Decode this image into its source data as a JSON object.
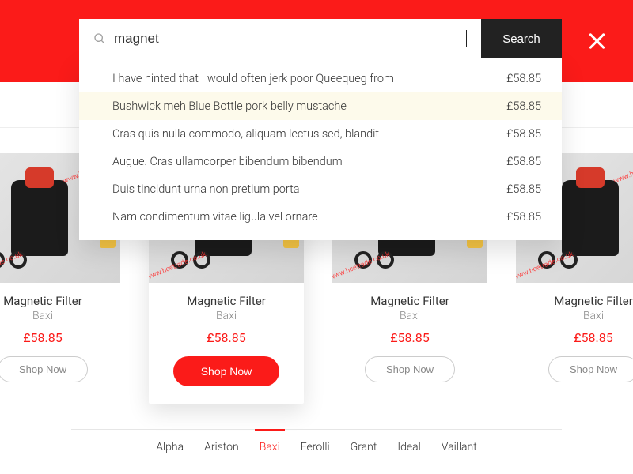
{
  "search": {
    "value": "magnet",
    "button": "Search"
  },
  "suggestions": [
    {
      "text": "I have hinted that I would often jerk poor Queequeg from",
      "price": "£58.85",
      "highlight": false
    },
    {
      "text": "Bushwick meh Blue Bottle pork belly mustache",
      "price": "£58.85",
      "highlight": true
    },
    {
      "text": "Cras quis nulla commodo, aliquam lectus sed, blandit",
      "price": "£58.85",
      "highlight": false
    },
    {
      "text": "Augue. Cras ullamcorper bibendum bibendum",
      "price": "£58.85",
      "highlight": false
    },
    {
      "text": "Duis tincidunt urna non pretium porta",
      "price": "£58.85",
      "highlight": false
    },
    {
      "text": "Nam condimentum vitae ligula vel ornare",
      "price": "£58.85",
      "highlight": false
    }
  ],
  "watermark": "www.hcetrade.co.uk",
  "products": [
    {
      "name": "Magnetic Filter",
      "brand": "Baxi",
      "price": "£58.85",
      "cta": "Shop Now",
      "featured": false
    },
    {
      "name": "Magnetic Filter",
      "brand": "Baxi",
      "price": "£58.85",
      "cta": "Shop Now",
      "featured": true
    },
    {
      "name": "Magnetic Filter",
      "brand": "Baxi",
      "price": "£58.85",
      "cta": "Shop Now",
      "featured": false
    },
    {
      "name": "Magnetic Filter",
      "brand": "Baxi",
      "price": "£58.85",
      "cta": "Shop Now",
      "featured": false
    }
  ],
  "tabs": [
    {
      "label": "Alpha",
      "active": false
    },
    {
      "label": "Ariston",
      "active": false
    },
    {
      "label": "Baxi",
      "active": true
    },
    {
      "label": "Ferolli",
      "active": false
    },
    {
      "label": "Grant",
      "active": false
    },
    {
      "label": "Ideal",
      "active": false
    },
    {
      "label": "Vaillant",
      "active": false
    }
  ]
}
